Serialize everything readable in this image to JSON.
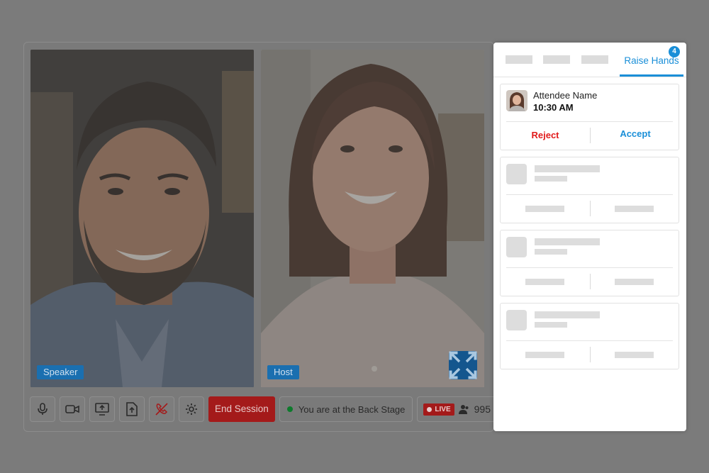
{
  "videos": [
    {
      "label": "Speaker"
    },
    {
      "label": "Host"
    }
  ],
  "toolbar": {
    "icons": [
      "microphone-icon",
      "video-camera-icon",
      "screen-share-icon",
      "upload-icon",
      "end-call-icon",
      "settings-icon"
    ],
    "end_session_label": "End Session",
    "status_text": "You are at the Back Stage",
    "live_label": "LIVE",
    "viewer_count": "995"
  },
  "panel": {
    "active_tab": "Raise Hands",
    "active_tab_badge": "4",
    "attendee": {
      "name": "Attendee Name",
      "time": "10:30 AM",
      "reject_label": "Reject",
      "accept_label": "Accept"
    },
    "placeholder_cards": 3
  },
  "colors": {
    "accent": "#1a8fd8",
    "reject": "#e11b1b",
    "end_session": "#a41a1a",
    "live_dot_status": "#0d7a2c"
  }
}
